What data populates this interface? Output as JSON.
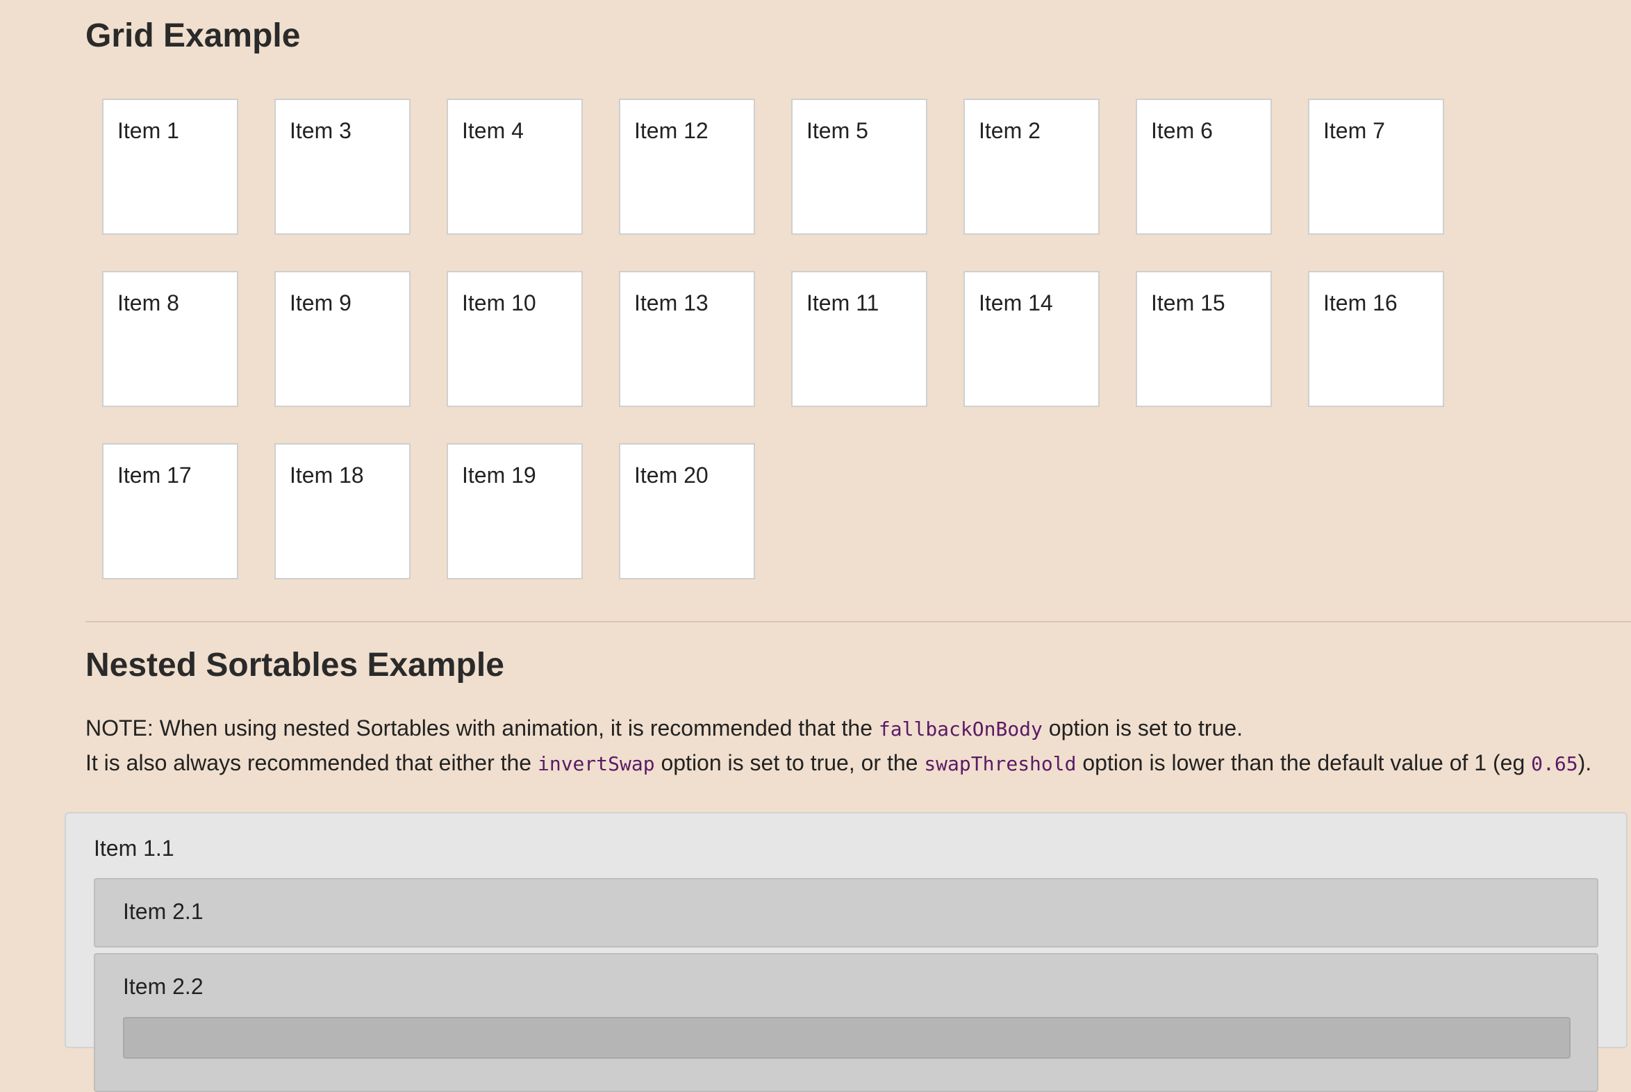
{
  "grid_example": {
    "title": "Grid Example",
    "items": [
      "Item 1",
      "Item 3",
      "Item 4",
      "Item 12",
      "Item 5",
      "Item 2",
      "Item 6",
      "Item 7",
      "Item 8",
      "Item 9",
      "Item 10",
      "Item 13",
      "Item 11",
      "Item 14",
      "Item 15",
      "Item 16",
      "Item 17",
      "Item 18",
      "Item 19",
      "Item 20"
    ]
  },
  "nested_example": {
    "title": "Nested Sortables Example",
    "note": {
      "line1_a": "NOTE: When using nested Sortables with animation, it is recommended that the ",
      "line1_code": "fallbackOnBody",
      "line1_b": " option is set to true.",
      "line2_a": "It is also always recommended that either the ",
      "line2_code1": "invertSwap",
      "line2_b": " option is set to true, or the ",
      "line2_code2": "swapThreshold",
      "line2_c": " option is lower than the default value of 1 (eg ",
      "line2_code3": "0.65",
      "line2_d": ")."
    },
    "items": {
      "level1": "Item 1.1",
      "level2": [
        "Item 2.1",
        "Item 2.2"
      ]
    }
  }
}
